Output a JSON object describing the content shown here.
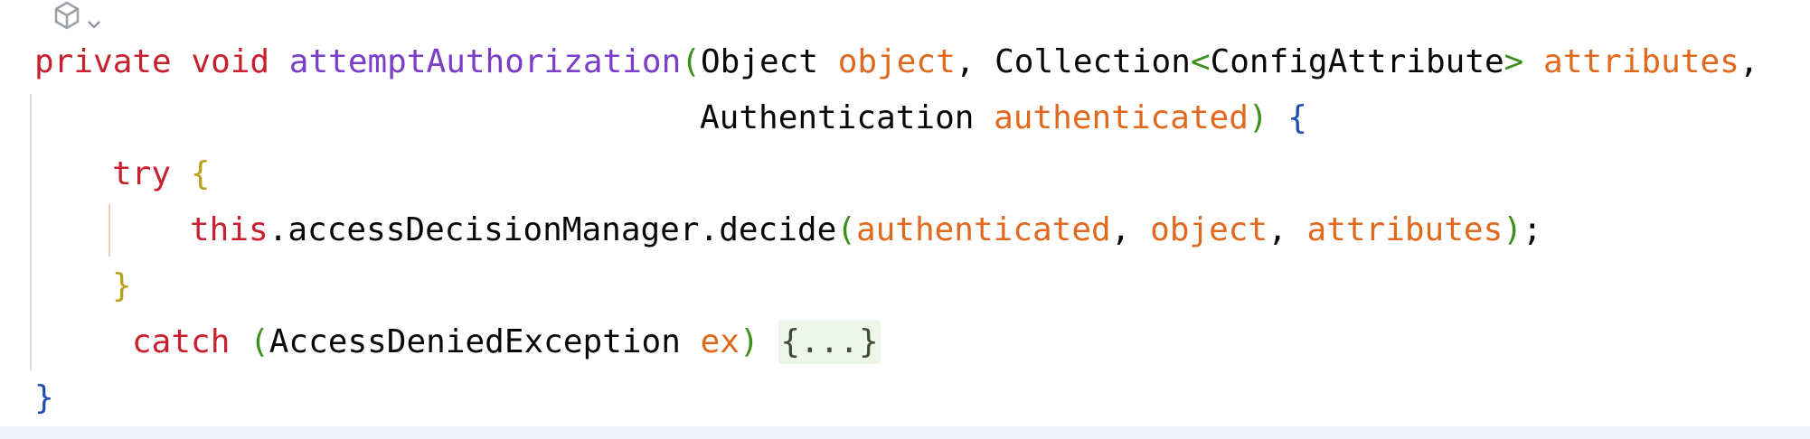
{
  "gutter": {
    "icon": "ai-assistant-icon",
    "dropdown_icon": "chevron-down-icon"
  },
  "code": {
    "line1": {
      "kw_private": "private",
      "kw_void": "void",
      "method_name": "attemptAuthorization",
      "open_paren": "(",
      "type_object": "Object",
      "param_object": "object",
      "comma1": ",",
      "type_collection": "Collection",
      "lt": "<",
      "type_config": "ConfigAttribute",
      "gt": ">",
      "param_attributes": "attributes",
      "comma2": ","
    },
    "line2": {
      "type_authentication": "Authentication",
      "param_authenticated": "authenticated",
      "close_paren": ")",
      "open_brace": "{"
    },
    "line3": {
      "kw_try": "try",
      "open_brace": "{"
    },
    "line4": {
      "kw_this": "this",
      "call": ".accessDecisionManager.decide",
      "open_paren": "(",
      "arg_authenticated": "authenticated",
      "comma1": ",",
      "arg_object": "object",
      "comma2": ",",
      "arg_attributes": "attributes",
      "close_paren": ")",
      "semicolon": ";"
    },
    "line5": {
      "close_brace": "}"
    },
    "line6": {
      "kw_catch": "catch",
      "open_paren": "(",
      "type_exception": "AccessDeniedException",
      "param_ex": "ex",
      "close_paren": ")",
      "folded_block": "{...}"
    },
    "line7": {
      "close_brace": "}"
    }
  },
  "colors": {
    "keyword": "#c8202e",
    "method": "#7a3ec8",
    "parameter": "#e0691d",
    "paren_level1": "#3e8f1c",
    "brace_level1": "#1f4db5",
    "brace_level2": "#b8a01a",
    "plain": "#080808",
    "fold_background": "#eef6ea"
  }
}
